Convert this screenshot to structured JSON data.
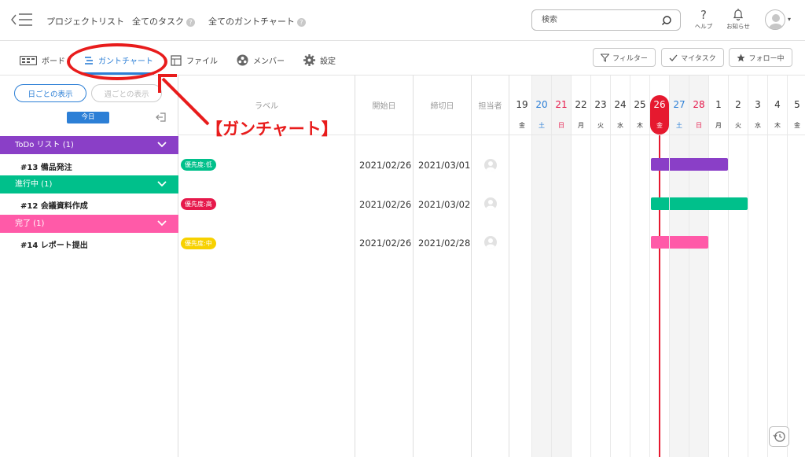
{
  "header": {
    "nav": [
      "プロジェクトリスト",
      "全てのタスク",
      "全てのガントチャート"
    ],
    "search_placeholder": "検索",
    "help_label": "ヘルプ",
    "help_glyph": "?",
    "notice_label": "お知らせ",
    "caret": "▾"
  },
  "tabs": [
    {
      "label": "ボード",
      "icon": "board-icon"
    },
    {
      "label": "ガントチャート",
      "icon": "gantt-icon",
      "active": true
    },
    {
      "label": "ファイル",
      "icon": "file-icon"
    },
    {
      "label": "メンバー",
      "icon": "member-icon"
    },
    {
      "label": "設定",
      "icon": "gear-icon"
    }
  ],
  "actions": {
    "filter": "フィルター",
    "mytask": "マイタスク",
    "follow": "フォロー中"
  },
  "left": {
    "daily_view": "日ごとの表示",
    "weekly_view": "週ごとの表示",
    "today": "今日"
  },
  "groups": [
    {
      "label": "ToDo リスト (1)",
      "color": "#8a3fc7",
      "task": "#13 備品発注"
    },
    {
      "label": "進行中 (1)",
      "color": "#00c08b",
      "task": "#12 会議資料作成"
    },
    {
      "label": "完了 (1)",
      "color": "#ff5aa8",
      "task": "#14 レポート提出"
    }
  ],
  "columns": {
    "label": "ラベル",
    "start": "開始日",
    "end": "締切日",
    "assignee": "担当者"
  },
  "rows": [
    {
      "badge": "優先度:低",
      "badge_color": "#00c08b",
      "start": "2021/02/26",
      "end": "2021/03/01",
      "bar_color": "#8a3fc7"
    },
    {
      "badge": "優先度:高",
      "badge_color": "#e6194b",
      "start": "2021/02/26",
      "end": "2021/03/02",
      "bar_color": "#00c08b"
    },
    {
      "badge": "優先度:中",
      "badge_color": "#f7d100",
      "start": "2021/02/26",
      "end": "2021/02/28",
      "bar_color": "#ff5aa8"
    }
  ],
  "days": [
    {
      "num": "19",
      "wd": "金"
    },
    {
      "num": "20",
      "wd": "土"
    },
    {
      "num": "21",
      "wd": "日"
    },
    {
      "num": "22",
      "wd": "月"
    },
    {
      "num": "23",
      "wd": "火"
    },
    {
      "num": "24",
      "wd": "水"
    },
    {
      "num": "25",
      "wd": "木"
    },
    {
      "num": "26",
      "wd": "金"
    },
    {
      "num": "27",
      "wd": "土"
    },
    {
      "num": "28",
      "wd": "日"
    },
    {
      "num": "1",
      "wd": "月"
    },
    {
      "num": "2",
      "wd": "火"
    },
    {
      "num": "3",
      "wd": "水"
    },
    {
      "num": "4",
      "wd": "木"
    },
    {
      "num": "5",
      "wd": "金"
    }
  ],
  "colors": {
    "accent": "#2c7fd6",
    "today": "#e6192f",
    "saturday": "#2c7fd6",
    "sunday": "#e6194b",
    "annotation": "#e81c1c"
  },
  "annotation": "【ガンチャート】"
}
